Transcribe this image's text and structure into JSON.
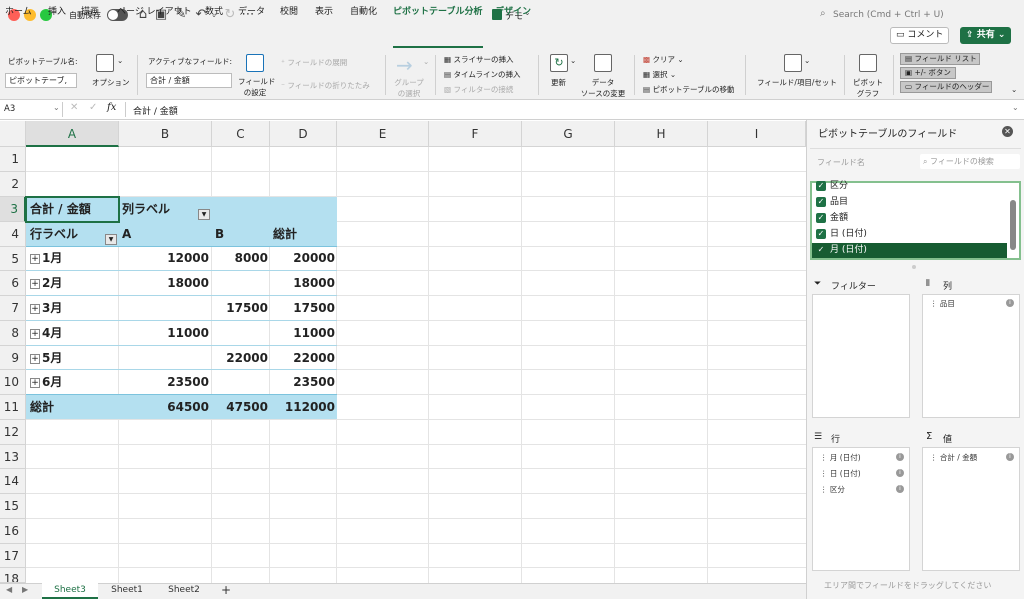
{
  "titlebar": {
    "autosave_label": "自動保存",
    "doc_title": "デモ",
    "search_placeholder": "Search (Cmd + Ctrl + U)"
  },
  "tabs": [
    "ホーム",
    "挿入",
    "描画",
    "ページ レイアウト",
    "数式",
    "データ",
    "校閲",
    "表示",
    "自動化",
    "ピボットテーブル分析",
    "デザイン"
  ],
  "active_tab": "ピボットテーブル分析",
  "top_buttons": {
    "comment": "コメント",
    "share": "共有"
  },
  "ribbon": {
    "pivot_name_label": "ピボットテーブル名:",
    "pivot_name_value": "ピボットテーブ,",
    "options": "オプション",
    "active_field_label": "アクティブなフィールド:",
    "active_field_value": "合計 / 金額",
    "field_settings_1": "フィールド",
    "field_settings_2": "の設定",
    "expand_field": "フィールドの展開",
    "collapse_field": "フィールドの折りたたみ",
    "group_1": "グループ",
    "group_2": "の選択",
    "insert_slicer": "スライサーの挿入",
    "insert_timeline": "タイムラインの挿入",
    "filter_connections": "フィルターの接続",
    "refresh": "更新",
    "data_source_1": "データ",
    "data_source_2": "ソースの変更",
    "clear": "クリア",
    "select": "選択",
    "move_pivot": "ピボットテーブルの移動",
    "fields_items_sets": "フィールド/項目/セット",
    "pivot_chart_1": "ピボット",
    "pivot_chart_2": "グラフ",
    "field_list": "フィールド リスト",
    "plus_minus_buttons": "+/- ボタン",
    "field_headers": "フィールドのヘッダー"
  },
  "formula_bar": {
    "cell_ref": "A3",
    "fx": "fx",
    "content": "合計 / 金額"
  },
  "columns": [
    "A",
    "B",
    "C",
    "D",
    "E",
    "F",
    "G",
    "H",
    "I"
  ],
  "rows": [
    "1",
    "2",
    "3",
    "4",
    "5",
    "6",
    "7",
    "8",
    "9",
    "10",
    "11",
    "12",
    "13",
    "14",
    "15",
    "16",
    "17",
    "18"
  ],
  "pivot": {
    "value_header": "合計 / 金額",
    "col_labels": "列ラベル",
    "row_labels": "行ラベル",
    "col_a": "A",
    "col_b": "B",
    "grand_total_header": "総計",
    "data_rows": [
      {
        "label": "1月",
        "a": "12000",
        "b": "8000",
        "total": "20000"
      },
      {
        "label": "2月",
        "a": "18000",
        "b": "",
        "total": "18000"
      },
      {
        "label": "3月",
        "a": "",
        "b": "17500",
        "total": "17500"
      },
      {
        "label": "4月",
        "a": "11000",
        "b": "",
        "total": "11000"
      },
      {
        "label": "5月",
        "a": "",
        "b": "22000",
        "total": "22000"
      },
      {
        "label": "6月",
        "a": "23500",
        "b": "",
        "total": "23500"
      }
    ],
    "grand_total_row": {
      "label": "総計",
      "a": "64500",
      "b": "47500",
      "total": "112000"
    }
  },
  "sheets": [
    "Sheet3",
    "Sheet1",
    "Sheet2"
  ],
  "active_sheet": "Sheet3",
  "pane": {
    "title": "ピボットテーブルのフィールド",
    "field_name_label": "フィールド名",
    "field_search_placeholder": "フィールドの検索",
    "fields": [
      {
        "label": "区分",
        "checked": true
      },
      {
        "label": "品目",
        "checked": true
      },
      {
        "label": "金額",
        "checked": true
      },
      {
        "label": "日 (日付)",
        "checked": true
      },
      {
        "label": "月 (日付)",
        "checked": true
      }
    ],
    "filter_label": "フィルター",
    "columns_label": "列",
    "rows_label": "行",
    "values_label": "値",
    "columns_items": [
      "品目"
    ],
    "rows_items": [
      "月 (日付)",
      "日 (日付)",
      "区分"
    ],
    "values_items": [
      "合計 / 金額"
    ],
    "drag_hint": "エリア間でフィールドをドラッグしてください"
  },
  "colors": {
    "accent": "#1e7145",
    "pivot_band": "#b4e0f0"
  }
}
